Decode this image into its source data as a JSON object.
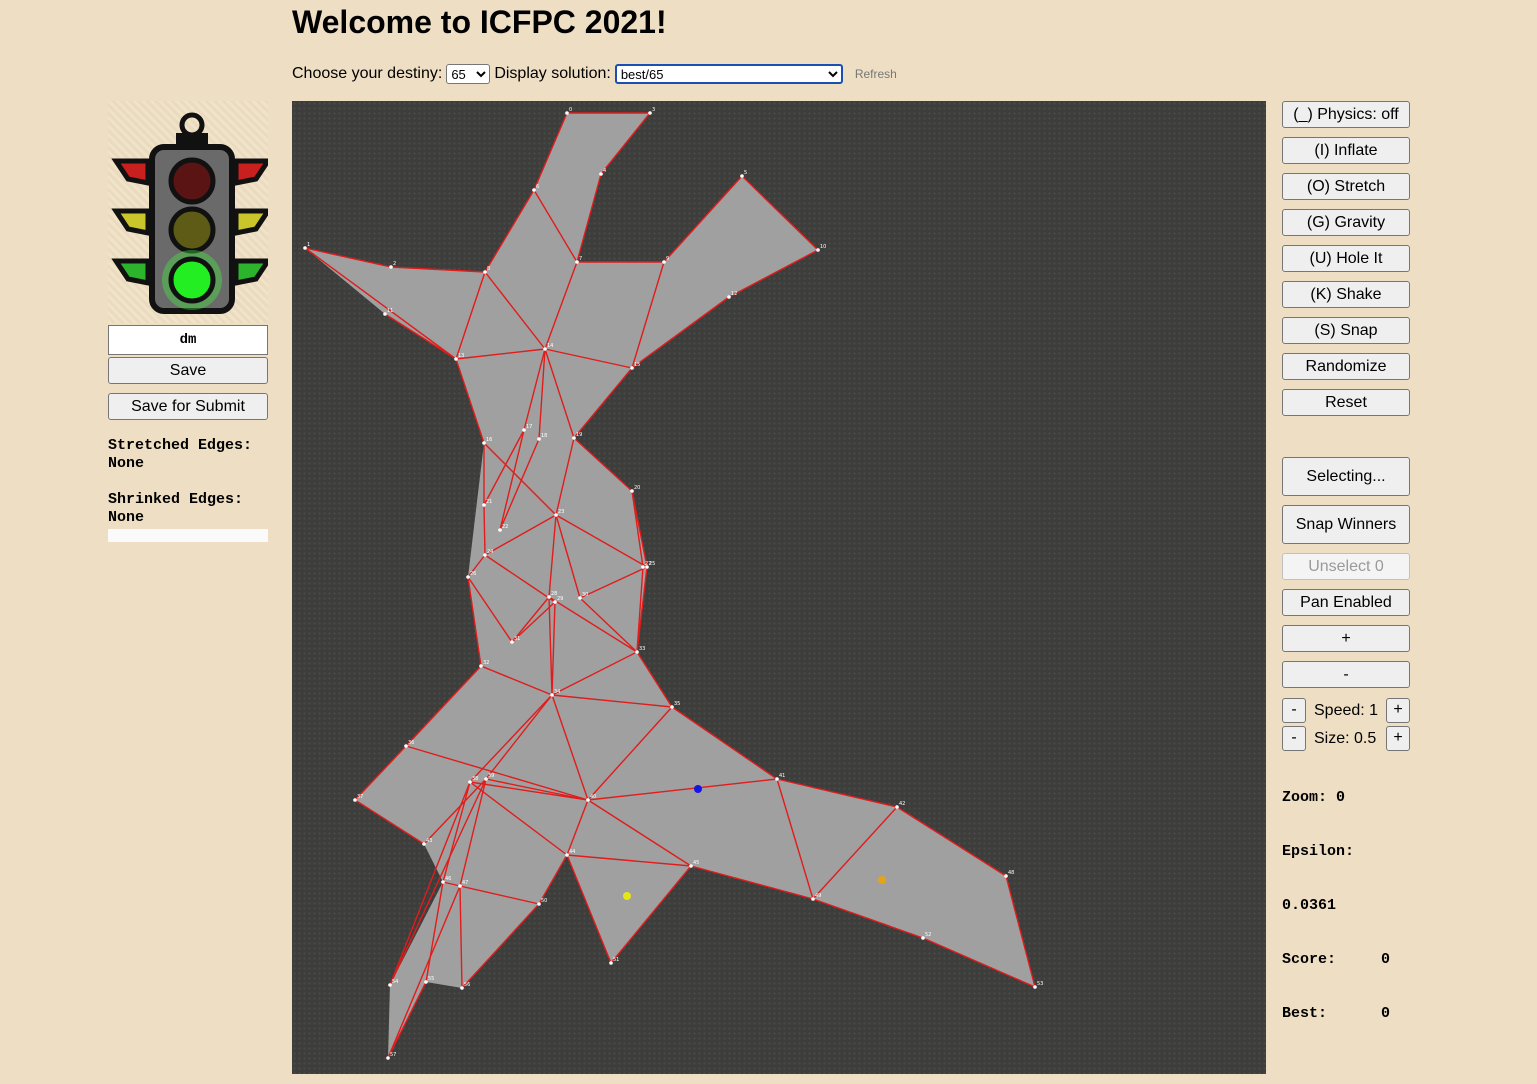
{
  "header": {
    "title": "Welcome to ICFPC 2021!"
  },
  "controls": {
    "destiny_label": "Choose your destiny:",
    "destiny_value": "65",
    "solution_label": "Display solution:",
    "solution_value": "best/65",
    "refresh_label": "Refresh"
  },
  "left_panel": {
    "name_value": "dm",
    "save_label": "Save",
    "save_submit_label": "Save for Submit",
    "stretched_label": "Stretched Edges:",
    "stretched_value": "None",
    "shrinked_label": "Shrinked Edges:",
    "shrinked_value": "None"
  },
  "right_panel": {
    "buttons": [
      "(_) Physics: off",
      "(I) Inflate",
      "(O) Stretch",
      "(G) Gravity",
      "(U) Hole It",
      "(K) Shake",
      "(S) Snap",
      "Randomize",
      "Reset"
    ],
    "selecting_label": "Selecting...",
    "snap_winners_label": "Snap Winners",
    "unselect_label": "Unselect 0",
    "pan_label": "Pan Enabled",
    "zoom_in_label": "+",
    "zoom_out_label": "-",
    "speed_minus": "-",
    "speed_label": "Speed: 1",
    "speed_plus": "+",
    "size_minus": "-",
    "size_label": "Size: 0.5",
    "size_plus": "+",
    "zoom_text": "Zoom: 0",
    "epsilon_label": "Epsilon:",
    "epsilon_value": "0.0361",
    "score_text": "Score:     0",
    "best_text": "Best:      0"
  },
  "colors": {
    "background": "#eedfc4",
    "canvas": "#3d3d3b",
    "hole_fill": "#a0a0a0",
    "edge": "#e01c1c",
    "bonus_blue": "#1515e6",
    "bonus_yellow": "#e6e617",
    "bonus_orange": "#e6a317"
  },
  "figure": {
    "vertex_labels": [
      "0",
      "1",
      "2",
      "3",
      "4",
      "5",
      "6",
      "7",
      "8",
      "9",
      "10",
      "11",
      "12",
      "13",
      "14",
      "15",
      "16",
      "17",
      "18",
      "19",
      "20",
      "21",
      "22",
      "23",
      "24",
      "25",
      "26",
      "27",
      "28",
      "29",
      "30",
      "31",
      "32",
      "33",
      "34",
      "35",
      "36",
      "37",
      "38",
      "39",
      "40",
      "41",
      "42",
      "43",
      "44",
      "45",
      "46",
      "47",
      "48",
      "49",
      "50",
      "51",
      "52",
      "53",
      "54",
      "55",
      "56",
      "57"
    ]
  }
}
